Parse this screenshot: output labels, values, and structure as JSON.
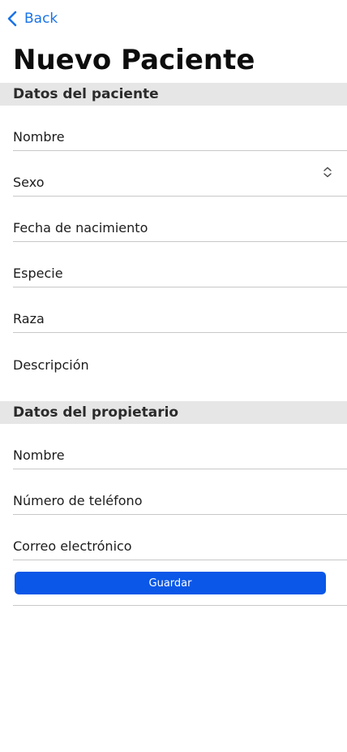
{
  "nav": {
    "back_label": "Back"
  },
  "title": "Nuevo Paciente",
  "patient_section": {
    "header": "Datos del paciente",
    "fields": {
      "name": "Nombre",
      "sex": "Sexo",
      "birthdate": "Fecha de nacimiento",
      "species": "Especie",
      "breed": "Raza",
      "description": "Descripción"
    }
  },
  "owner_section": {
    "header": "Datos del propietario",
    "fields": {
      "name": "Nombre",
      "phone": "Número de teléfono",
      "email": "Correo electrónico"
    }
  },
  "save_button": "Guardar",
  "colors": {
    "accent": "#1a73e8",
    "button": "#0a57e8",
    "section_bg": "#e6e6e6"
  },
  "icons": {
    "back": "chevron-left-icon",
    "select": "chevron-up-down-icon"
  }
}
